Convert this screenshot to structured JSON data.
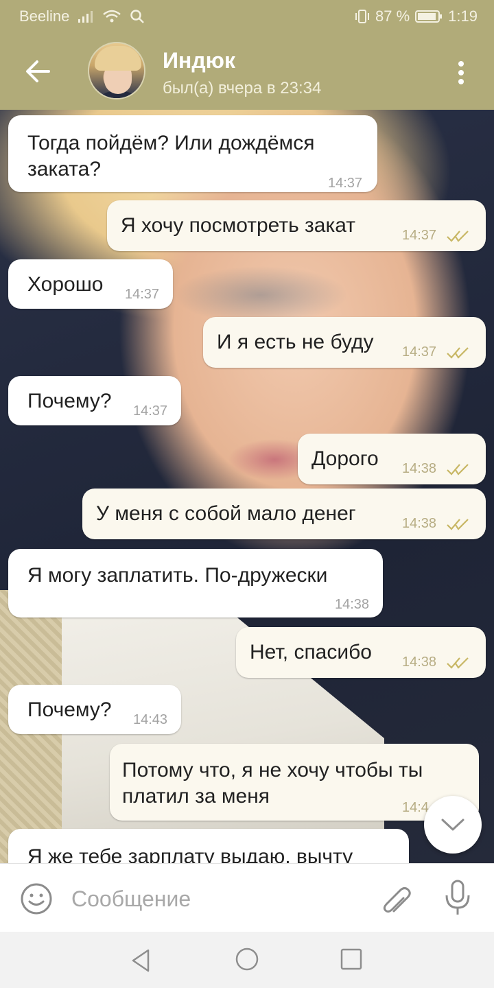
{
  "status_bar": {
    "carrier": "Beeline",
    "battery_percent": "87 %",
    "time": "1:19",
    "icons": [
      "signal-icon",
      "wifi-icon",
      "search-icon",
      "vibrate-icon",
      "battery-icon"
    ]
  },
  "header": {
    "name": "Индюк",
    "last_seen": "был(а) вчера в 23:34",
    "back_icon": "arrow-left-icon",
    "menu_icon": "more-vertical-icon"
  },
  "messages": [
    {
      "dir": "in",
      "text": "Тогда пойдём? Или дождёмся\nзаката?",
      "time": "14:37"
    },
    {
      "dir": "out",
      "text": "Я хочу посмотреть закат",
      "time": "14:37",
      "read": true
    },
    {
      "dir": "in",
      "text": "Хорошо",
      "time": "14:37"
    },
    {
      "dir": "out",
      "text": "И я есть не буду",
      "time": "14:37",
      "read": true
    },
    {
      "dir": "in",
      "text": "Почему?",
      "time": "14:37"
    },
    {
      "dir": "out",
      "text": "Дорого",
      "time": "14:38",
      "read": true
    },
    {
      "dir": "out",
      "text": "У меня с собой мало денег",
      "time": "14:38",
      "read": true
    },
    {
      "dir": "in",
      "text": "Я могу заплатить. По-дружески",
      "time": "14:38"
    },
    {
      "dir": "out",
      "text": "Нет, спасибо",
      "time": "14:38",
      "read": true
    },
    {
      "dir": "in",
      "text": "Почему?",
      "time": "14:43"
    },
    {
      "dir": "out",
      "text": "Потому что, я не хочу чтобы ты\nплатил за меня",
      "time": "14:4",
      "read": false
    },
    {
      "dir": "in",
      "text": "Я же тебе зарплату выдаю, вычту",
      "time": ""
    }
  ],
  "input": {
    "placeholder": "Сообщение",
    "value": ""
  },
  "colors": {
    "header": "#b1ab79",
    "incoming_bubble": "#ffffff",
    "outgoing_bubble": "#fbf8ee",
    "read_ticks": "#c8b765"
  }
}
